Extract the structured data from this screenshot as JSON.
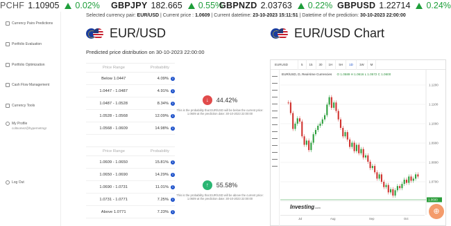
{
  "ticker": [
    {
      "symbol": "PCHF",
      "price": "1.10905",
      "change": "0.02%"
    },
    {
      "symbol": "GBPJPY",
      "price": "182.665",
      "change": "0.55%"
    },
    {
      "symbol": "GBPNZD",
      "price": "2.03763",
      "change": "0.22%"
    },
    {
      "symbol": "GBPUSD",
      "price": "1.22714",
      "change": "0.24%"
    }
  ],
  "sidebar": {
    "items": [
      {
        "label": "Currency Pairs Predictions"
      },
      {
        "label": "Portfolio Evaluation"
      },
      {
        "label": "Portfolio Optimization"
      },
      {
        "label": "Cash Flow Management"
      },
      {
        "label": "Currency Tools"
      },
      {
        "label": "My Profile",
        "sub": "coltsomez@hypernetmgr"
      },
      {
        "label": "Log Out"
      }
    ]
  },
  "header": {
    "pair_label": "Selected currency pair:",
    "pair": "EUR/USD",
    "price_label": "| Current price :",
    "price": "1.0609",
    "datetime_label": "| Current datetime:",
    "datetime": "23-10-2023 15:11:51",
    "pred_label": "| Datetime of the prediction:",
    "pred_datetime": "30-10-2023 22:00:00"
  },
  "main": {
    "title": "EUR/USD",
    "chart_title": "EUR/USD Chart",
    "prediction_title": "Predicted price distribution on 30-10-2023 22:00:00",
    "col_range": "Price Range",
    "col_prob": "Probability",
    "below_rows": [
      {
        "range": "Below 1.0447",
        "prob": "4.09%"
      },
      {
        "range": "1.0447 - 1.0487",
        "prob": "4.91%"
      },
      {
        "range": "1.0487 - 1.0528",
        "prob": "8.34%"
      },
      {
        "range": "1.0528 - 1.0568",
        "prob": "12.09%"
      },
      {
        "range": "1.0568 - 1.0609",
        "prob": "14.98%"
      }
    ],
    "above_rows": [
      {
        "range": "1.0609 - 1.0650",
        "prob": "15.81%"
      },
      {
        "range": "1.0650 - 1.0690",
        "prob": "14.29%"
      },
      {
        "range": "1.0690 - 1.0731",
        "prob": "11.01%"
      },
      {
        "range": "1.0731 - 1.0771",
        "prob": "7.25%"
      },
      {
        "range": "Above 1.0771",
        "prob": "7.23%"
      }
    ],
    "below_summary": {
      "pct": "44.42%",
      "text": "This is the probability that EUR/USD will be below the current price: 1.0609 at the prediction date: 30-10-2023 22:00:00"
    },
    "above_summary": {
      "pct": "55.58%",
      "text": "This is the probability that EUR/USD will be above the current price: 1.0609 at the prediction date: 30-10-2023 22:00:00"
    }
  },
  "chart_widget": {
    "symbol": "EURUSD",
    "intervals": [
      "5",
      "15",
      "30",
      "1H",
      "5H",
      "1D",
      "1W",
      "M"
    ],
    "active_interval": "1D",
    "legend": "EUR/USD, D, Real-time Currencies",
    "ohlc": "O 1.0589 H 1.0616 L 1.0572 C 1.0600",
    "price_ticks": [
      "1.1200",
      "1.1100",
      "1.1000",
      "1.0900",
      "1.0800",
      "1.0700",
      "1.0600"
    ],
    "last_price": "1.0600",
    "x_labels": [
      "Jul",
      "Aug",
      "Sep",
      "Oct"
    ],
    "logo": "Investing",
    "logo_suffix": ".com",
    "colors": {
      "up": "#2a9d3a",
      "down": "#d0312d",
      "last_price": "#2a9d3a"
    }
  }
}
